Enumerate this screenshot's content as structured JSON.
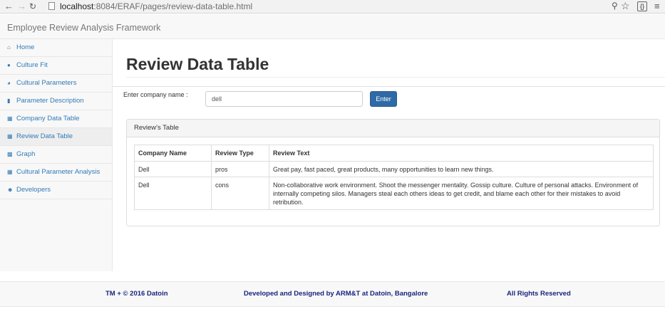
{
  "browser": {
    "url_host": "localhost",
    "url_rest": ":8084/ERAF/pages/review-data-table.html"
  },
  "app": {
    "brand": "Employee Review Analysis Framework"
  },
  "sidebar": {
    "items": [
      {
        "label": "Home",
        "icon": "home-icon"
      },
      {
        "label": "Culture Fit",
        "icon": "binoculars-icon"
      },
      {
        "label": "Cultural Parameters",
        "icon": "tachometer-icon"
      },
      {
        "label": "Parameter Description",
        "icon": "file-icon"
      },
      {
        "label": "Company Data Table",
        "icon": "table-icon"
      },
      {
        "label": "Review Data Table",
        "icon": "table-icon"
      },
      {
        "label": "Graph",
        "icon": "bar-chart-icon"
      },
      {
        "label": "Cultural Parameter Analysis",
        "icon": "table-icon"
      },
      {
        "label": "Developers",
        "icon": "users-icon"
      }
    ]
  },
  "main": {
    "title": "Review Data Table",
    "company_label": "Enter company name :",
    "company_value": "dell",
    "enter_label": "Enter",
    "panel_heading": "Review's Table",
    "table": {
      "headers": [
        "Company Name",
        "Review Type",
        "Review Text"
      ],
      "rows": [
        [
          "Dell",
          "pros",
          "Great pay, fast paced, great products, many opportunities to learn new things."
        ],
        [
          "Dell",
          "cons",
          "Non-collaborative work environment. Shoot the messenger mentality. Gossip culture. Culture of personal attacks. Environment of internally competing silos. Managers steal each others ideas to get credit, and blame each other for their mistakes to avoid retribution."
        ]
      ]
    }
  },
  "footer": {
    "copyright": "TM + © 2016 Datoin",
    "developed": "Developed and Designed by ARM&T at Datoin, Bangalore",
    "rights": "All Rights Reserved"
  },
  "colors": {
    "link": "#337ab7",
    "button": "#2e6aa7",
    "footer_text": "#1a237e"
  }
}
